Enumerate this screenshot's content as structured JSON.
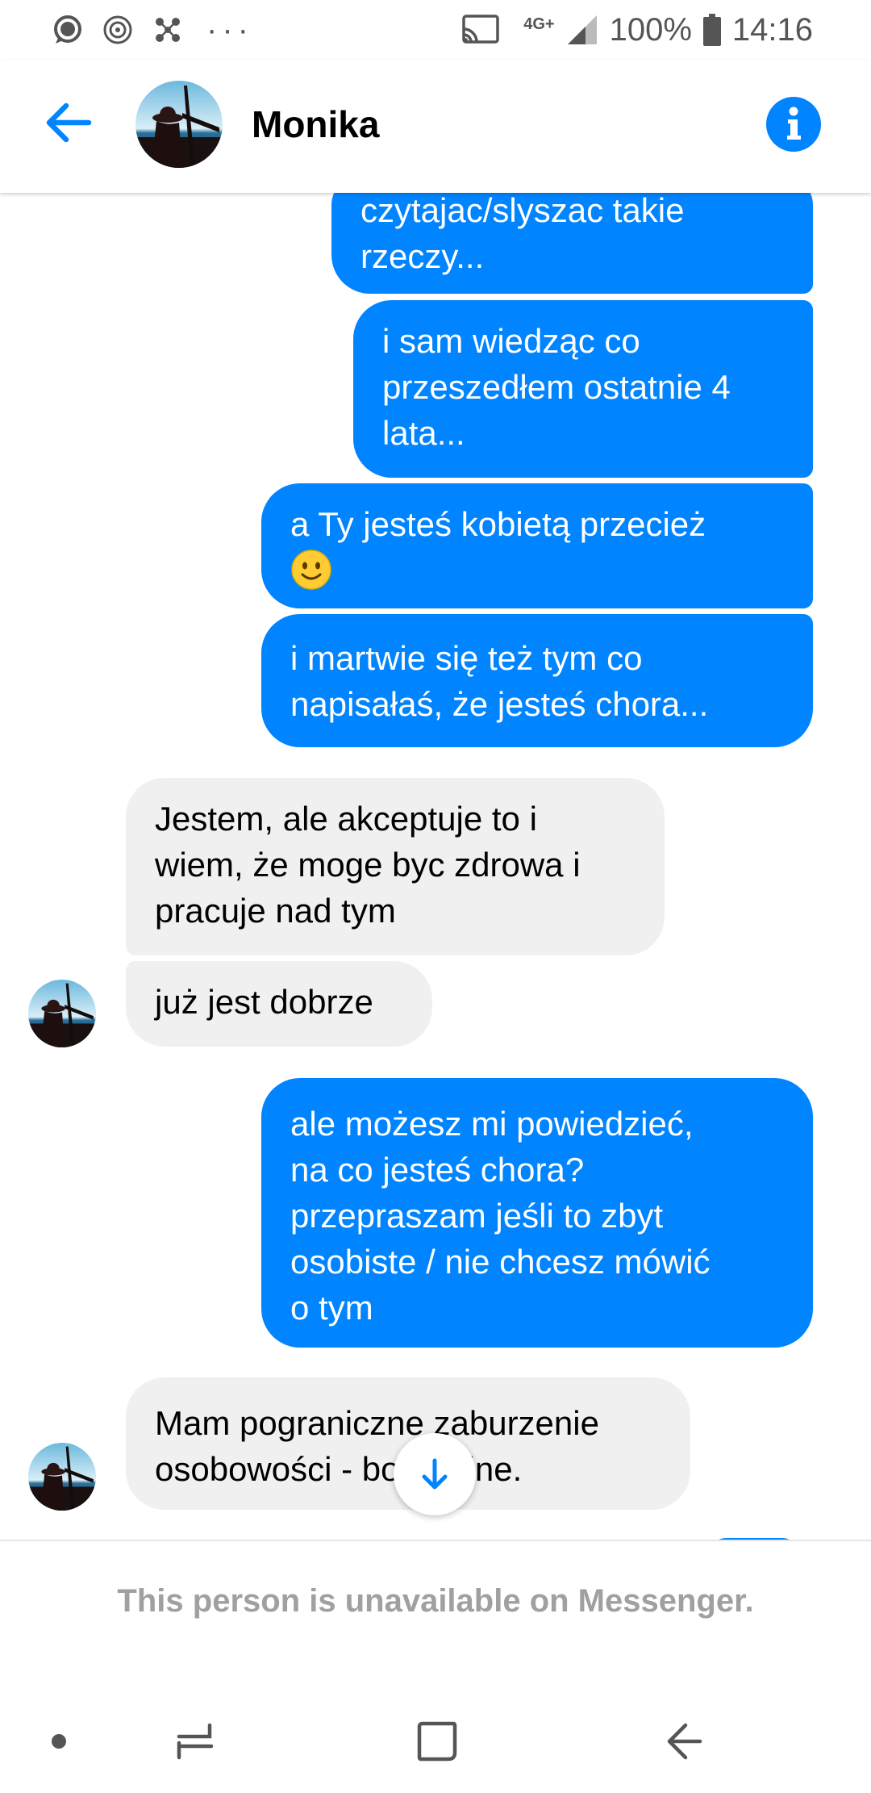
{
  "status_bar": {
    "battery": "100%",
    "time": "14:16",
    "network": "4G+",
    "more": "···"
  },
  "header": {
    "contact_name": "Monika"
  },
  "messages": [
    {
      "direction": "out",
      "lines": [
        "czytajac/slyszac takie",
        "rzeczy..."
      ]
    },
    {
      "direction": "out",
      "lines": [
        "i sam wiedząc co",
        "przeszedłem ostatnie 4",
        "lata..."
      ]
    },
    {
      "direction": "out",
      "lines": [
        "a Ty jesteś kobietą przecież",
        "🙂"
      ]
    },
    {
      "direction": "out",
      "lines": [
        "i martwie się też tym co",
        "napisałaś, że jesteś chora..."
      ]
    },
    {
      "direction": "in",
      "lines": [
        "Jestem, ale akceptuje to i",
        "wiem, że moge byc zdrowa i",
        "pracuje nad tym"
      ]
    },
    {
      "direction": "in",
      "lines": [
        "już jest dobrze"
      ]
    },
    {
      "direction": "out",
      "lines": [
        "ale możesz mi powiedzieć,",
        "na co jesteś chora?",
        "przepraszam jeśli to zbyt",
        "osobiste / nie chcesz mówić",
        "o tym"
      ]
    },
    {
      "direction": "in",
      "lines": [
        "Mam pograniczne zaburzenie",
        "osobowości - borderline."
      ]
    }
  ],
  "footer": {
    "unavailable_text": "This person is unavailable on Messenger."
  },
  "colors": {
    "accent": "#0084ff",
    "incoming_bubble": "#f0f0f0"
  },
  "icons": {
    "back": "arrow-left-icon",
    "info": "info-icon",
    "scroll": "arrow-down-icon"
  }
}
